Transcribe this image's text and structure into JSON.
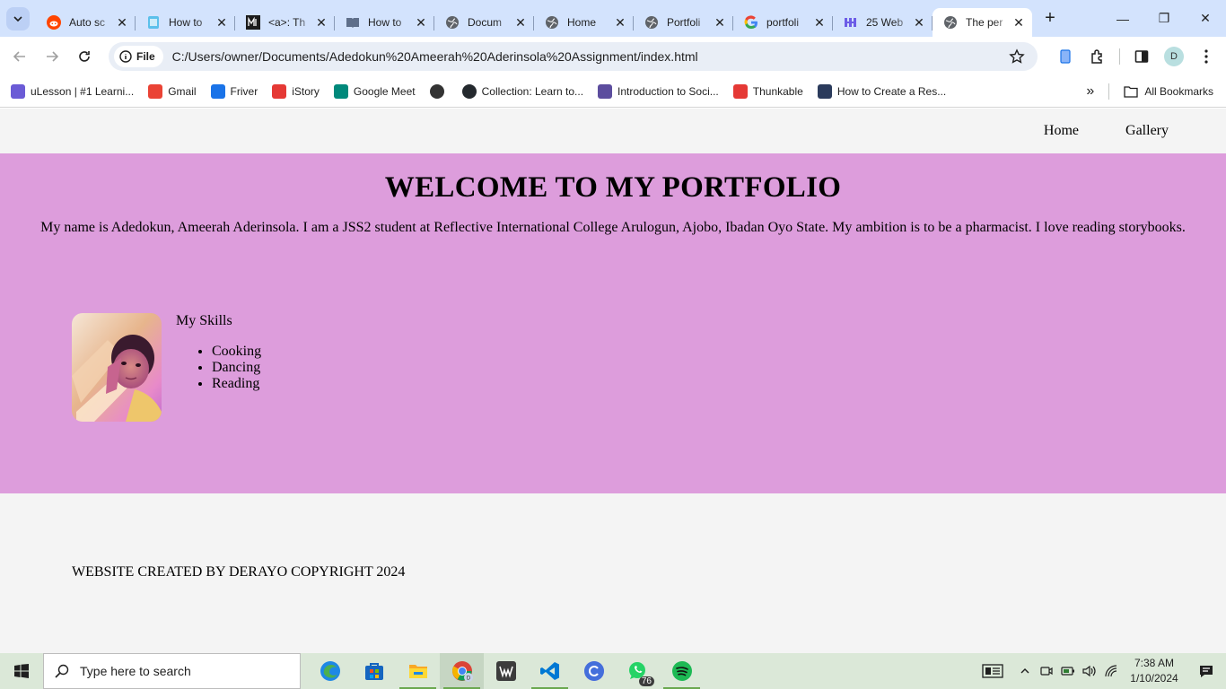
{
  "browser": {
    "tabs": [
      {
        "title": "Auto sc",
        "icon": "reddit-icon",
        "active": false
      },
      {
        "title": "How to",
        "icon": "page-icon",
        "active": false
      },
      {
        "title": "<a>: Th",
        "icon": "mdn-icon",
        "active": false
      },
      {
        "title": "How to",
        "icon": "book-icon",
        "active": false
      },
      {
        "title": "Docum",
        "icon": "globe-icon",
        "active": false
      },
      {
        "title": "Home",
        "icon": "globe-icon",
        "active": false
      },
      {
        "title": "Portfoli",
        "icon": "globe-icon",
        "active": false
      },
      {
        "title": "portfoli",
        "icon": "google-icon",
        "active": false
      },
      {
        "title": "25 Web",
        "icon": "webflow-icon",
        "active": false
      },
      {
        "title": "The per",
        "icon": "globe-icon",
        "active": true
      }
    ],
    "scheme_chip": "File",
    "url": "C:/Users/owner/Documents/Adedokun%20Ameerah%20Aderinsola%20Assignment/index.html",
    "profile_initial": "D",
    "bookmarks": [
      {
        "label": "uLesson | #1 Learni...",
        "icon": "ulesson-icon",
        "color": "#6b5bd6"
      },
      {
        "label": "Gmail",
        "icon": "gmail-icon",
        "color": "#ea4335"
      },
      {
        "label": "Friver",
        "icon": "friver-icon",
        "color": "#1a73e8"
      },
      {
        "label": "iStory",
        "icon": "istory-icon",
        "color": "#e53935"
      },
      {
        "label": "Google Meet",
        "icon": "meet-icon",
        "color": "#00897b"
      },
      {
        "label": "",
        "icon": "globe-icon",
        "color": "#333333"
      },
      {
        "label": "Collection: Learn to...",
        "icon": "github-icon",
        "color": "#24292e"
      },
      {
        "label": "Introduction to Soci...",
        "icon": "crest-icon",
        "color": "#5c4d9e"
      },
      {
        "label": "Thunkable",
        "icon": "thunkable-icon",
        "color": "#e53935"
      },
      {
        "label": "How to Create a Res...",
        "icon": "w3-icon",
        "color": "#2b3b5c"
      }
    ],
    "all_bookmarks": "All Bookmarks"
  },
  "site": {
    "nav": {
      "home": "Home",
      "gallery": "Gallery"
    },
    "hero": {
      "title": "WELCOME TO MY PORTFOLIO",
      "intro": "My name is Adedokun, Ameerah Aderinsola. I am a JSS2 student at Reflective International College Arulogun, Ajobo, Ibadan Oyo State. My ambition is to be a pharmacist. I love reading storybooks."
    },
    "skills": {
      "heading": "My Skills",
      "items": [
        "Cooking",
        "Dancing",
        "Reading"
      ]
    },
    "footer": "WEBSITE CREATED BY DERAYO COPYRIGHT 2024",
    "colors": {
      "hero_bg": "#dd9ddc",
      "page_bg": "#f4f4f4"
    }
  },
  "taskbar": {
    "search_placeholder": "Type here to search",
    "apps": [
      {
        "name": "edge-icon",
        "open": false
      },
      {
        "name": "store-icon",
        "open": false
      },
      {
        "name": "explorer-icon",
        "open": true
      },
      {
        "name": "chrome-icon",
        "open": true
      },
      {
        "name": "wattpad-icon",
        "open": false
      },
      {
        "name": "vscode-icon",
        "open": true
      },
      {
        "name": "canva-icon",
        "open": false
      },
      {
        "name": "whatsapp-icon",
        "open": false
      },
      {
        "name": "spotify-icon",
        "open": true
      }
    ],
    "whatsapp_badge": "76",
    "time": "7:38 AM",
    "date": "1/10/2024"
  }
}
